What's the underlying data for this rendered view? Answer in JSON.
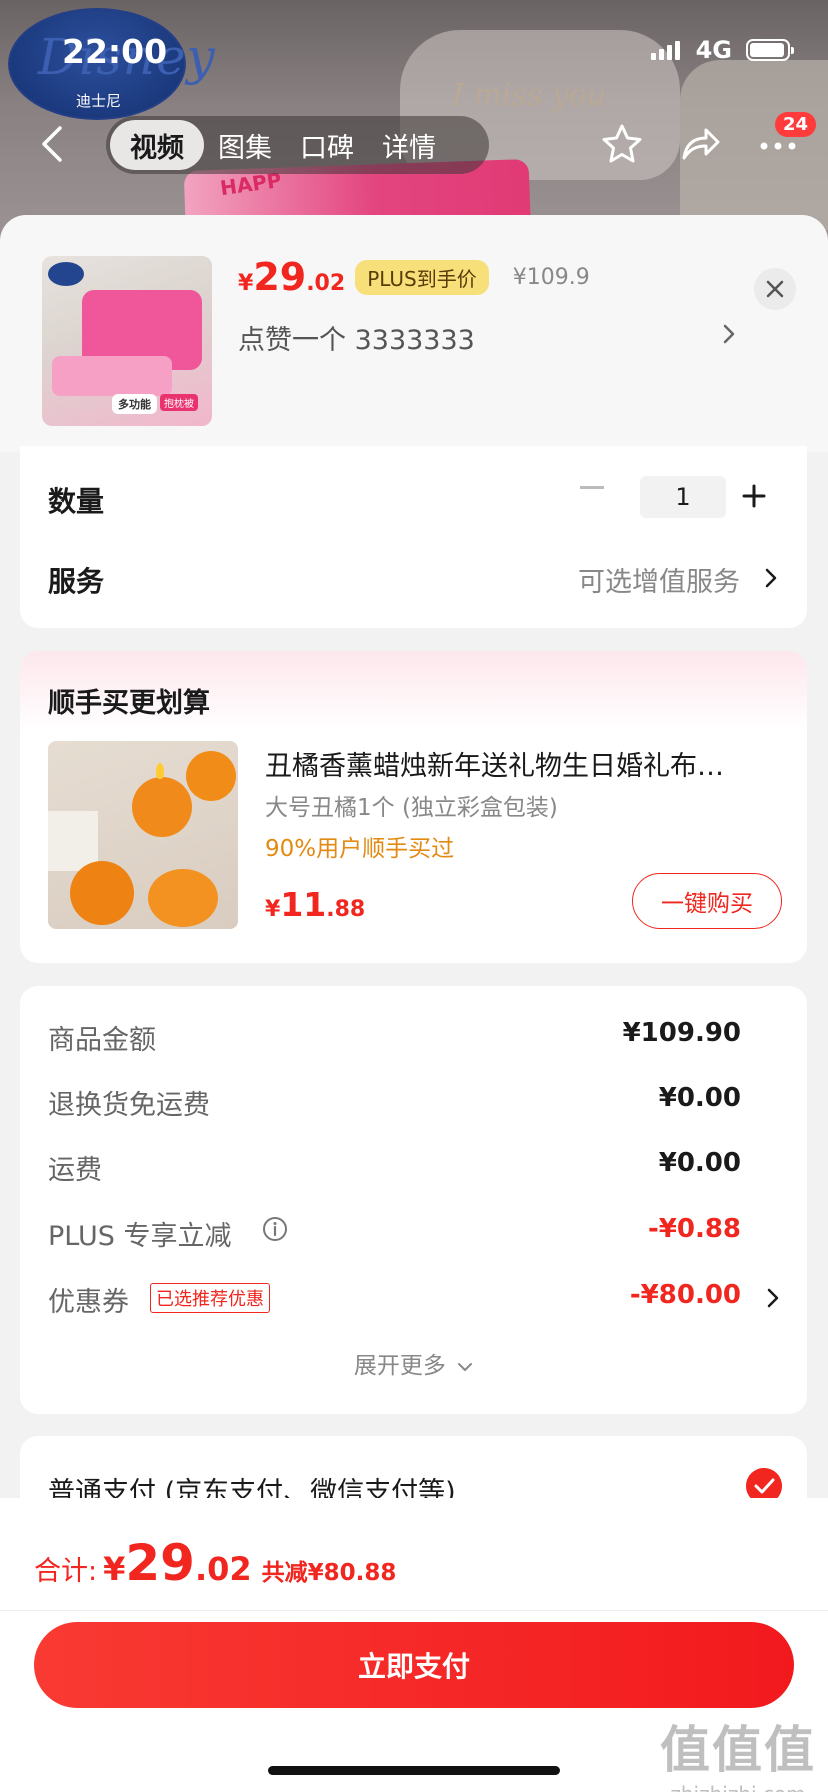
{
  "status_bar": {
    "time": "22:00",
    "network": "4G",
    "battery_level": 0.95
  },
  "backdrop": {
    "pillow_text": "I miss you",
    "pink_text": "HAPP",
    "brand_script": "Disney",
    "brand_cn": "迪士尼"
  },
  "nav": {
    "tabs": [
      {
        "label": "视频",
        "active": true
      },
      {
        "label": "图集",
        "active": false
      },
      {
        "label": "口碑",
        "active": false
      },
      {
        "label": "详情",
        "active": false
      }
    ],
    "message_badge": "24"
  },
  "product": {
    "price_currency": "¥",
    "price_int": "29",
    "price_dec": ".02",
    "plus_tag": "PLUS到手价",
    "original_price": "¥109.9",
    "selected_spec": "点赞一个  3333333",
    "thumb_tag": "多功能",
    "thumb_tag2": "抱枕被"
  },
  "options": {
    "quantity_label": "数量",
    "quantity_value": "1",
    "service_label": "服务",
    "service_value": "可选增值服务"
  },
  "bundle": {
    "title": "顺手买更划算",
    "name": "丑橘香薰蜡烛新年送礼物生日婚礼布…",
    "spec": "大号丑橘1个 (独立彩盒包装)",
    "percent_text": "90%用户顺手买过",
    "price_currency": "¥",
    "price_int": "11",
    "price_dec": ".88",
    "buy_button": "一键购买"
  },
  "summary": {
    "rows": [
      {
        "label": "商品金额",
        "value": "¥109.90"
      },
      {
        "label": "退换货免运费",
        "value": "¥0.00"
      },
      {
        "label": "运费",
        "value": "¥0.00"
      },
      {
        "label": "PLUS 专享立减",
        "value": "-¥0.88"
      },
      {
        "label": "优惠券",
        "value": "-¥80.00"
      }
    ],
    "coupon_tag": "已选推荐优惠",
    "expand_more": "展开更多"
  },
  "payment": {
    "method_label": "普通支付 (京东支付、微信支付等)"
  },
  "footer": {
    "total_label": "合计:",
    "total_currency": "¥",
    "total_int": "29",
    "total_dec": ".02",
    "total_saved": "共减¥80.88",
    "pay_button": "立即支付"
  },
  "watermark": {
    "main": "值值值",
    "sub": "zhizhizhi.com"
  },
  "colors": {
    "accent": "#f0261f",
    "plus_gold": "#f7e07a",
    "orange_text": "#e38a13"
  }
}
